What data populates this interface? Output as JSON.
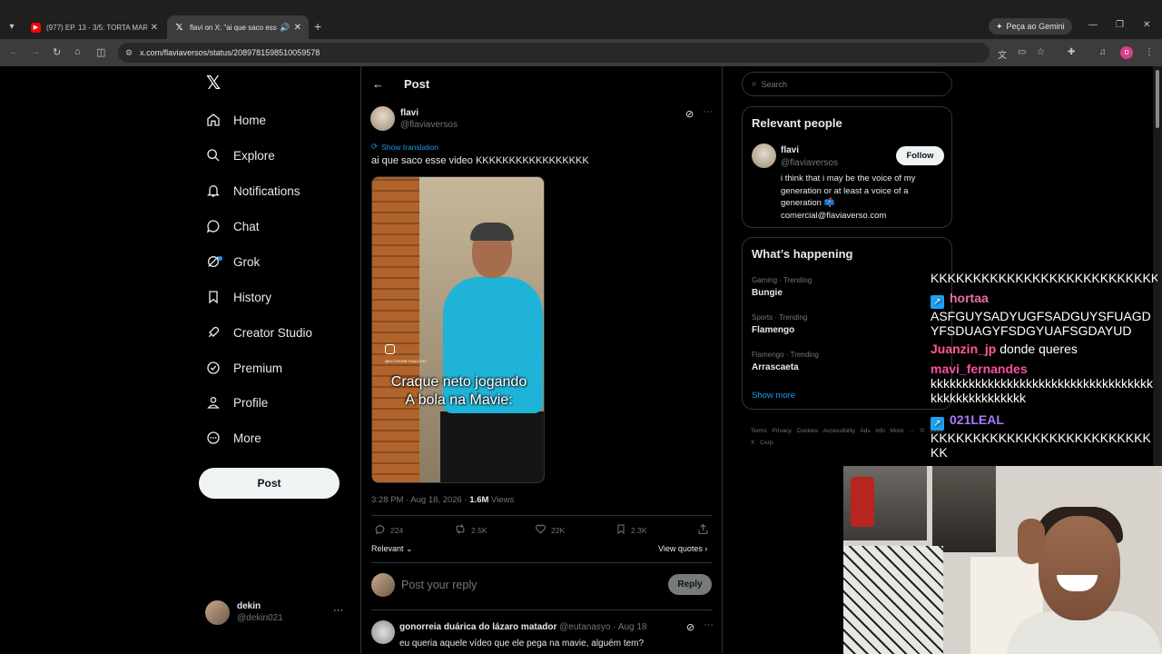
{
  "browser": {
    "tabs": [
      {
        "title": "(977) EP. 13 - 3/5: TORTA MART",
        "favicon": "youtube-icon"
      },
      {
        "title": "flavi on X: \"ai que saco esse",
        "favicon": "x-icon",
        "active": true
      }
    ],
    "gemini_label": "Peça ao Gemini",
    "url": "x.com/flaviaversos/status/2089781598510059578",
    "profile_initial": "D"
  },
  "nav": {
    "items": [
      {
        "label": "Home",
        "icon": "home-icon"
      },
      {
        "label": "Explore",
        "icon": "search-icon"
      },
      {
        "label": "Notifications",
        "icon": "bell-icon"
      },
      {
        "label": "Chat",
        "icon": "chat-icon"
      },
      {
        "label": "Grok",
        "icon": "grok-icon"
      },
      {
        "label": "History",
        "icon": "bookmark-icon"
      },
      {
        "label": "Creator Studio",
        "icon": "rocket-icon"
      },
      {
        "label": "Premium",
        "icon": "verified-icon"
      },
      {
        "label": "Profile",
        "icon": "person-icon"
      },
      {
        "label": "More",
        "icon": "more-circle-icon"
      }
    ],
    "post_button": "Post",
    "account": {
      "name": "dekin",
      "handle": "@dekin021"
    }
  },
  "post": {
    "header": "Post",
    "author": {
      "name": "flavi",
      "handle": "@flaviaversos"
    },
    "show_translation": "Show translation",
    "text": "ai que saco esse video KKKKKKKKKKKKKKKKK",
    "video_caption_1": "Craque neto jogando",
    "video_caption_2": "A bola na Mavie:",
    "video_handle": "@ELTONJNEYGAUCHO",
    "time": "3:28 PM · Aug 18, 2026 · ",
    "views_count": "1.6M",
    "views_label": " Views",
    "stats": {
      "replies": "224",
      "reposts": "2.5K",
      "likes": "22K",
      "bookmarks": "2.3K"
    },
    "sort_label": "Relevant",
    "view_quotes": "View quotes",
    "reply_placeholder": "Post your reply",
    "reply_button": "Reply"
  },
  "reply": {
    "name": "gonorreia duárica do lázaro matador",
    "handle": "@eutanasyo",
    "date": "· Aug 18",
    "text": "eu queria aquele vídeo que ele pega na mavie, alguém tem?"
  },
  "sidebar": {
    "search_placeholder": "Search",
    "relevant_title": "Relevant people",
    "person": {
      "name": "flavi",
      "handle": "@flaviaversos",
      "follow": "Follow",
      "bio_1": "i think that i may be the voice of my generation or at least a voice of a generation 📫",
      "bio_2": "comercial@flaviaverso.com"
    },
    "happening_title": "What’s happening",
    "trends": [
      {
        "category": "Gaming · Trending",
        "name": "Bungie"
      },
      {
        "category": "Sports · Trending",
        "name": "Flamengo"
      },
      {
        "category": "Flamengo · Trending",
        "name": "Arrascaeta"
      }
    ],
    "show_more": "Show more",
    "footer": "Terms  Privacy  Cookies  Accessibility  Ads info  More ···  © 2026 X Corp."
  },
  "chat": {
    "messages": [
      {
        "user": "",
        "text": "KKKKKKKKKKKKKKKKKKKKKKKKKKK",
        "color": "#ffffff"
      },
      {
        "user": "hortaa",
        "text": "ASFGUYSADYUGFSADGUYSFUAGDYFSDUAGYFSDGYUAFSGDAYUD",
        "color": "#e86fa8"
      },
      {
        "user": "Juanzin_jp",
        "text": "donde queres",
        "color": "#ff5a9a"
      },
      {
        "user": "mavi_fernandes",
        "text": "kkkkkkkkkkkkkkkkkkkkkkkkkkkkkkkkkkkkkkkkkkkkkkkkkk",
        "color": "#ff4fa0"
      },
      {
        "user": "021LEAL",
        "text": "KKKKKKKKKKKKKKKKKKKKKKKKKKKK",
        "color": "#a77bff"
      }
    ]
  }
}
